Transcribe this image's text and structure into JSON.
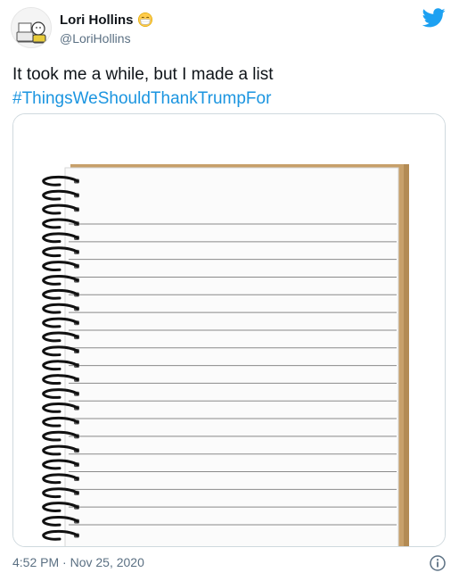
{
  "tweet": {
    "display_name": "Lori Hollins",
    "handle": "@LoriHollins",
    "text_line": "It took me a while, but I made a list",
    "hashtag": "#ThingsWeShouldThankTrumpFor",
    "timestamp": "4:52 PM · Nov 25, 2020"
  },
  "icons": {
    "name_emoji": "face-with-medical-mask-icon",
    "brand": "twitter-bird-icon",
    "info": "info-icon"
  },
  "colors": {
    "hashtag": "#1b95e0",
    "handle": "#5b7083",
    "brand": "#1da1f2",
    "notebook_cover": "#c7a06a",
    "notebook_rule": "#8a8a8a"
  },
  "media": {
    "description_kind": "blank spiral notebook",
    "ruled_lines": 18,
    "spiral_rings": 26
  }
}
